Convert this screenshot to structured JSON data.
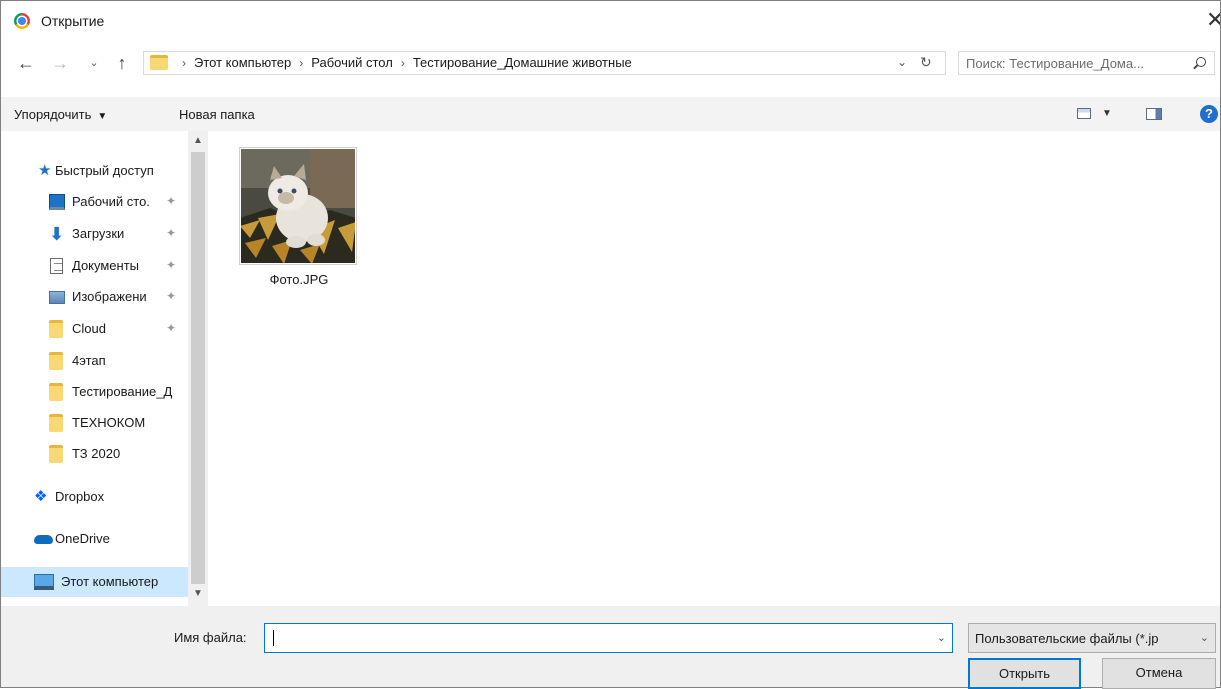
{
  "window": {
    "title": "Открытие",
    "close_glyph": "✕"
  },
  "navigation": {
    "back_glyph": "←",
    "forward_glyph": "→",
    "recent_glyph": "⌄",
    "up_glyph": "↑",
    "breadcrumb": [
      "Этот компьютер",
      "Рабочий стол",
      "Тестирование_Домашние животные"
    ],
    "separator": "›",
    "dropdown_glyph": "⌄",
    "refresh_glyph": "↻"
  },
  "search": {
    "placeholder": "Поиск: Тестирование_Дома..."
  },
  "toolbar": {
    "organize_label": "Упорядочить",
    "organize_caret": "▼",
    "new_folder_label": "Новая папка",
    "view_caret": "▼",
    "help_glyph": "?"
  },
  "sidebar": {
    "items": [
      {
        "label": "Быстрый доступ",
        "icon": "star-icon"
      },
      {
        "label": "Рабочий сто.",
        "icon": "desktop-icon",
        "pinned": true
      },
      {
        "label": "Загрузки",
        "icon": "download-icon",
        "pinned": true
      },
      {
        "label": "Документы",
        "icon": "document-icon",
        "pinned": true
      },
      {
        "label": "Изображени",
        "icon": "pictures-icon",
        "pinned": true
      },
      {
        "label": "Cloud",
        "icon": "folder-icon",
        "pinned": true
      },
      {
        "label": "4этап",
        "icon": "folder-icon"
      },
      {
        "label": "Тестирование_Д",
        "icon": "folder-icon"
      },
      {
        "label": "ТЕХНОКОМ",
        "icon": "folder-icon"
      },
      {
        "label": "ТЗ 2020",
        "icon": "folder-icon"
      },
      {
        "label": "Dropbox",
        "icon": "dropbox-icon"
      },
      {
        "label": "OneDrive",
        "icon": "onedrive-icon"
      },
      {
        "label": "Этот компьютер",
        "icon": "computer-icon",
        "selected": true
      }
    ],
    "pin_glyph": "📌",
    "scroll_up": "▲",
    "scroll_down": "▼"
  },
  "files": [
    {
      "name": "Фото.JPG",
      "type": "image-thumbnail"
    }
  ],
  "footer": {
    "filename_label": "Имя файла:",
    "filename_value": "",
    "filename_dropdown": "⌄",
    "filetype_value": "Пользовательские файлы (*.jp",
    "filetype_dropdown": "⌄",
    "open_label": "Открыть",
    "cancel_label": "Отмена"
  },
  "colors": {
    "accent": "#0078d7",
    "selection": "#cce8ff",
    "toolbar_bg": "#f3f3f3",
    "footer_bg": "#f0f0f0"
  }
}
